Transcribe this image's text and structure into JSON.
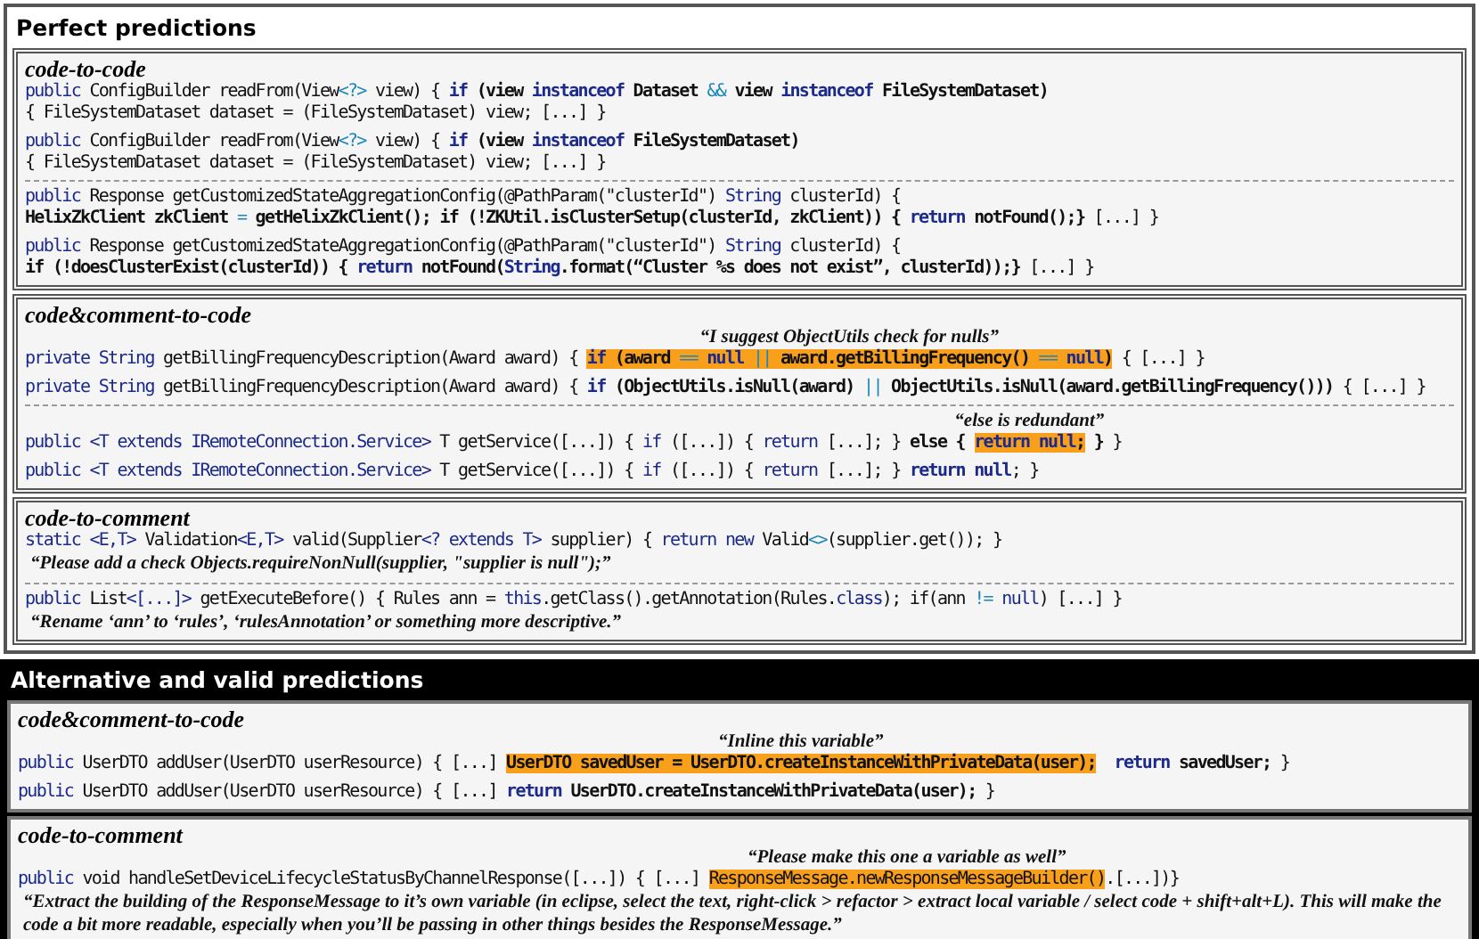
{
  "panels": [
    {
      "title": "Perfect predictions",
      "sections": [
        {
          "title": "code-to-code",
          "groups": [
            {
              "examples": [
                {
                  "lines": [
                    {
                      "kind": "code",
                      "segments": [
                        {
                          "kind": "keyword",
                          "text": "public"
                        },
                        {
                          "kind": "plain",
                          "text": " ConfigBuilder readFrom(View"
                        },
                        {
                          "kind": "operator",
                          "text": "<?>"
                        },
                        {
                          "kind": "plain",
                          "text": " view) { "
                        },
                        {
                          "kind": "keyword_bold",
                          "text": "if"
                        },
                        {
                          "kind": "bold",
                          "text": " (view "
                        },
                        {
                          "kind": "keyword_bold",
                          "text": "instanceof"
                        },
                        {
                          "kind": "bold",
                          "text": " Dataset "
                        },
                        {
                          "kind": "operator",
                          "text": "&&"
                        },
                        {
                          "kind": "bold",
                          "text": " view "
                        },
                        {
                          "kind": "keyword_bold",
                          "text": "instanceof"
                        },
                        {
                          "kind": "bold",
                          "text": " FileSystemDataset)"
                        }
                      ]
                    },
                    {
                      "kind": "code",
                      "segments": [
                        {
                          "kind": "plain",
                          "text": "{ FileSystemDataset dataset = (FileSystemDataset) view; [...] }"
                        }
                      ]
                    }
                  ]
                },
                {
                  "lines": [
                    {
                      "kind": "code",
                      "segments": [
                        {
                          "kind": "keyword",
                          "text": "public"
                        },
                        {
                          "kind": "plain",
                          "text": " ConfigBuilder readFrom(View"
                        },
                        {
                          "kind": "operator",
                          "text": "<?>"
                        },
                        {
                          "kind": "plain",
                          "text": " view) { "
                        },
                        {
                          "kind": "keyword_bold",
                          "text": "if"
                        },
                        {
                          "kind": "bold",
                          "text": " (view "
                        },
                        {
                          "kind": "keyword_bold",
                          "text": "instanceof"
                        },
                        {
                          "kind": "bold",
                          "text": " FileSystemDataset)"
                        }
                      ]
                    },
                    {
                      "kind": "code",
                      "segments": [
                        {
                          "kind": "plain",
                          "text": "{ FileSystemDataset dataset = (FileSystemDataset) view; [...] }"
                        }
                      ]
                    }
                  ]
                }
              ]
            },
            {
              "examples": [
                {
                  "lines": [
                    {
                      "kind": "code",
                      "segments": [
                        {
                          "kind": "keyword",
                          "text": "public"
                        },
                        {
                          "kind": "plain",
                          "text": " Response getCustomizedStateAggregationConfig(@PathParam(\"clusterId\") "
                        },
                        {
                          "kind": "keyword",
                          "text": "String"
                        },
                        {
                          "kind": "plain",
                          "text": " clusterId) {"
                        }
                      ]
                    },
                    {
                      "kind": "code",
                      "segments": [
                        {
                          "kind": "bold",
                          "text": "HelixZkClient zkClient "
                        },
                        {
                          "kind": "operator",
                          "text": "="
                        },
                        {
                          "kind": "bold",
                          "text": " getHelixZkClient(); if (!ZKUtil.isClusterSetup(clusterId, zkClient)) { "
                        },
                        {
                          "kind": "keyword_bold",
                          "text": "return"
                        },
                        {
                          "kind": "bold",
                          "text": " notFound();}"
                        },
                        {
                          "kind": "plain",
                          "text": " [...] }"
                        }
                      ]
                    }
                  ]
                },
                {
                  "lines": [
                    {
                      "kind": "code",
                      "segments": [
                        {
                          "kind": "keyword",
                          "text": "public"
                        },
                        {
                          "kind": "plain",
                          "text": " Response getCustomizedStateAggregationConfig(@PathParam(\"clusterId\") "
                        },
                        {
                          "kind": "keyword",
                          "text": "String"
                        },
                        {
                          "kind": "plain",
                          "text": " clusterId) {"
                        }
                      ]
                    },
                    {
                      "kind": "code",
                      "segments": [
                        {
                          "kind": "bold",
                          "text": "if (!doesClusterExist(clusterId)) { "
                        },
                        {
                          "kind": "keyword_bold",
                          "text": "return"
                        },
                        {
                          "kind": "bold",
                          "text": " notFound("
                        },
                        {
                          "kind": "keyword_bold",
                          "text": "String"
                        },
                        {
                          "kind": "bold",
                          "text": ".format(“Cluster %s does not exist”, clusterId));}"
                        },
                        {
                          "kind": "plain",
                          "text": " [...] }"
                        }
                      ]
                    }
                  ]
                }
              ]
            }
          ]
        },
        {
          "title": "code&comment-to-code",
          "groups": [
            {
              "examples": [
                {
                  "lines": [
                    {
                      "kind": "code",
                      "segments": [
                        {
                          "kind": "keyword",
                          "text": "private String"
                        },
                        {
                          "kind": "plain",
                          "text": " getBillingFrequencyDescription(Award award) { "
                        },
                        {
                          "kind": "highlight",
                          "note": "“I suggest ObjectUtils check for nulls”",
                          "segments": [
                            {
                              "kind": "keyword_bold",
                              "text": "if"
                            },
                            {
                              "kind": "bold",
                              "text": " (award "
                            },
                            {
                              "kind": "operator",
                              "text": "=="
                            },
                            {
                              "kind": "keyword_bold",
                              "text": " null "
                            },
                            {
                              "kind": "operator",
                              "text": "||"
                            },
                            {
                              "kind": "bold",
                              "text": " award.getBillingFrequency() "
                            },
                            {
                              "kind": "operator",
                              "text": "=="
                            },
                            {
                              "kind": "keyword_bold",
                              "text": " null"
                            },
                            {
                              "kind": "bold",
                              "text": ")"
                            }
                          ]
                        },
                        {
                          "kind": "plain",
                          "text": " { [...] }"
                        }
                      ]
                    }
                  ]
                },
                {
                  "lines": [
                    {
                      "kind": "code",
                      "segments": [
                        {
                          "kind": "keyword",
                          "text": "private String"
                        },
                        {
                          "kind": "plain",
                          "text": " getBillingFrequencyDescription(Award award) { "
                        },
                        {
                          "kind": "keyword_bold",
                          "text": "if"
                        },
                        {
                          "kind": "bold",
                          "text": " (ObjectUtils.isNull(award) "
                        },
                        {
                          "kind": "operator",
                          "text": "||"
                        },
                        {
                          "kind": "bold",
                          "text": " ObjectUtils.isNull(award.getBillingFrequency()))"
                        },
                        {
                          "kind": "plain",
                          "text": " { [...] }"
                        }
                      ]
                    }
                  ]
                }
              ]
            },
            {
              "examples": [
                {
                  "lines": [
                    {
                      "kind": "code",
                      "segments": [
                        {
                          "kind": "keyword",
                          "text": "public <T extends IRemoteConnection.Service>"
                        },
                        {
                          "kind": "plain",
                          "text": " T getService([...]) { "
                        },
                        {
                          "kind": "keyword",
                          "text": "if"
                        },
                        {
                          "kind": "plain",
                          "text": " ([...]) { "
                        },
                        {
                          "kind": "keyword",
                          "text": "return"
                        },
                        {
                          "kind": "plain",
                          "text": " [...]; } "
                        },
                        {
                          "kind": "bold",
                          "text": "else { "
                        },
                        {
                          "kind": "highlight",
                          "note": "“else is redundant”",
                          "segments": [
                            {
                              "kind": "keyword_bold",
                              "text": "return null"
                            },
                            {
                              "kind": "bold",
                              "text": ";"
                            }
                          ]
                        },
                        {
                          "kind": "bold",
                          "text": " }"
                        },
                        {
                          "kind": "plain",
                          "text": " }"
                        }
                      ]
                    }
                  ]
                },
                {
                  "lines": [
                    {
                      "kind": "code",
                      "segments": [
                        {
                          "kind": "keyword",
                          "text": "public <T extends IRemoteConnection.Service>"
                        },
                        {
                          "kind": "plain",
                          "text": " T getService([...]) { "
                        },
                        {
                          "kind": "keyword",
                          "text": "if"
                        },
                        {
                          "kind": "plain",
                          "text": " ([...]) { "
                        },
                        {
                          "kind": "keyword",
                          "text": "return"
                        },
                        {
                          "kind": "plain",
                          "text": " [...]; } "
                        },
                        {
                          "kind": "keyword_bold",
                          "text": "return null"
                        },
                        {
                          "kind": "plain",
                          "text": "; }"
                        }
                      ]
                    }
                  ]
                }
              ]
            }
          ]
        },
        {
          "title": "code-to-comment",
          "groups": [
            {
              "examples": [
                {
                  "lines": [
                    {
                      "kind": "code",
                      "segments": [
                        {
                          "kind": "keyword",
                          "text": "static <E,T>"
                        },
                        {
                          "kind": "plain",
                          "text": " Validation"
                        },
                        {
                          "kind": "keyword",
                          "text": "<E,T>"
                        },
                        {
                          "kind": "plain",
                          "text": " valid(Supplier"
                        },
                        {
                          "kind": "keyword",
                          "text": "<? extends T>"
                        },
                        {
                          "kind": "plain",
                          "text": " supplier) { "
                        },
                        {
                          "kind": "keyword",
                          "text": "return new"
                        },
                        {
                          "kind": "plain",
                          "text": " Valid"
                        },
                        {
                          "kind": "operator",
                          "text": "<>"
                        },
                        {
                          "kind": "plain",
                          "text": "(supplier.get()); }"
                        }
                      ]
                    },
                    {
                      "kind": "comment",
                      "text": "“Please add a check Objects.requireNonNull(supplier, \"supplier is null\");”"
                    }
                  ]
                }
              ]
            },
            {
              "examples": [
                {
                  "lines": [
                    {
                      "kind": "code",
                      "segments": [
                        {
                          "kind": "keyword",
                          "text": "public"
                        },
                        {
                          "kind": "plain",
                          "text": " List"
                        },
                        {
                          "kind": "keyword",
                          "text": "<[...]>"
                        },
                        {
                          "kind": "plain",
                          "text": " getExecuteBefore() { Rules ann = "
                        },
                        {
                          "kind": "keyword",
                          "text": "this"
                        },
                        {
                          "kind": "plain",
                          "text": ".getClass().getAnnotation(Rules."
                        },
                        {
                          "kind": "keyword",
                          "text": "class"
                        },
                        {
                          "kind": "plain",
                          "text": "); if(ann "
                        },
                        {
                          "kind": "operator",
                          "text": "!="
                        },
                        {
                          "kind": "keyword",
                          "text": " null"
                        },
                        {
                          "kind": "plain",
                          "text": ") [...] }"
                        }
                      ]
                    },
                    {
                      "kind": "comment",
                      "text": "“Rename ‘ann’ to ‘rules’, ‘rulesAnnotation’ or something more descriptive.”"
                    }
                  ]
                }
              ]
            }
          ]
        }
      ]
    },
    {
      "title": "Alternative and valid predictions",
      "sections": [
        {
          "title": "code&comment-to-code",
          "groups": [
            {
              "examples": [
                {
                  "lines": [
                    {
                      "kind": "code",
                      "segments": [
                        {
                          "kind": "keyword",
                          "text": "public"
                        },
                        {
                          "kind": "plain",
                          "text": " UserDTO addUser(UserDTO userResource) { [...] "
                        },
                        {
                          "kind": "highlight",
                          "note": "“Inline this variable”",
                          "segments": [
                            {
                              "kind": "bold",
                              "text": "UserDTO savedUser = UserDTO.createInstanceWithPrivateData(user);"
                            }
                          ]
                        },
                        {
                          "kind": "keyword_bold",
                          "text": "  return"
                        },
                        {
                          "kind": "bold",
                          "text": " savedUser;"
                        },
                        {
                          "kind": "plain",
                          "text": " }"
                        }
                      ]
                    }
                  ]
                },
                {
                  "lines": [
                    {
                      "kind": "code",
                      "segments": [
                        {
                          "kind": "keyword",
                          "text": "public"
                        },
                        {
                          "kind": "plain",
                          "text": " UserDTO addUser(UserDTO userResource) { [...] "
                        },
                        {
                          "kind": "keyword_bold",
                          "text": "return"
                        },
                        {
                          "kind": "bold",
                          "text": " UserDTO.createInstanceWithPrivateData(user);"
                        },
                        {
                          "kind": "plain",
                          "text": " }"
                        }
                      ]
                    }
                  ]
                }
              ]
            }
          ]
        },
        {
          "title": "code-to-comment",
          "groups": [
            {
              "examples": [
                {
                  "lines": [
                    {
                      "kind": "code",
                      "segments": [
                        {
                          "kind": "keyword",
                          "text": "public"
                        },
                        {
                          "kind": "plain",
                          "text": " void handleSetDeviceLifecycleStatusByChannelResponse([...]) { [...] "
                        },
                        {
                          "kind": "highlight",
                          "note": "“Please make this one a variable as well”",
                          "segments": [
                            {
                              "kind": "plain",
                              "text": "ResponseMessage.newResponseMessageBuilder()"
                            }
                          ]
                        },
                        {
                          "kind": "plain",
                          "text": ".[...])}"
                        }
                      ]
                    },
                    {
                      "kind": "comment",
                      "text": "“Extract the building of the ResponseMessage to it’s own variable (in eclipse, select the text, right-click > refactor > extract local variable / select code + shift+alt+L). This will make the code a bit more readable, especially when you’ll be passing in other things besides the ResponseMessage.”"
                    }
                  ]
                }
              ]
            }
          ]
        }
      ]
    }
  ]
}
